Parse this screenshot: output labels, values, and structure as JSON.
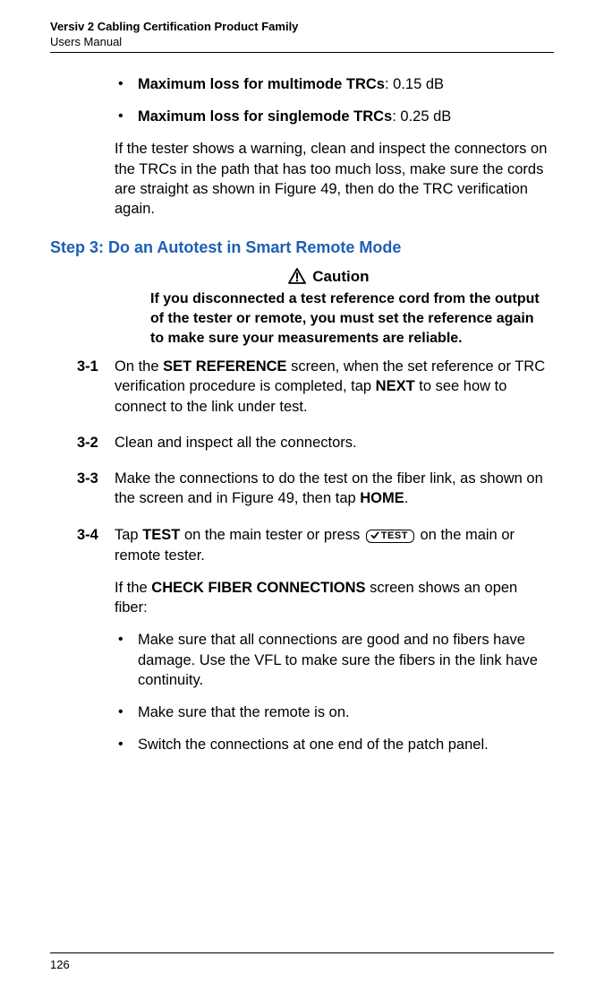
{
  "header": {
    "title": "Versiv 2 Cabling Certification Product Family",
    "subtitle": "Users Manual"
  },
  "bullets": {
    "mm_label": "Maximum loss for multimode TRCs",
    "mm_value": ": 0.15 dB",
    "sm_label": "Maximum loss for singlemode TRCs",
    "sm_value": ": 0.25 dB"
  },
  "warning_para": "If the tester shows a warning, clean and inspect the connectors on the TRCs in the path that has too much loss, make sure the cords are straight as shown in Figure 49, then do the TRC verification again.",
  "section_heading": "Step 3: Do an Autotest in Smart Remote Mode",
  "caution": {
    "label": "Caution",
    "body": "If you disconnected a test reference cord from the output of the tester or remote, you must set the reference again to make sure your measurements are reliable."
  },
  "steps": {
    "s1": {
      "num": "3-1",
      "pre": "On the ",
      "b1": "SET REFERENCE",
      "mid": " screen, when the set reference or TRC verification procedure is completed, tap ",
      "b2": "NEXT",
      "post": " to see how to connect to the link under test."
    },
    "s2": {
      "num": "3-2",
      "text": "Clean and inspect all the connectors."
    },
    "s3": {
      "num": "3-3",
      "pre": "Make the connections to do the test on the fiber link, as shown on the screen and in Figure 49, then tap ",
      "b1": "HOME",
      "post": "."
    },
    "s4": {
      "num": "3-4",
      "pre": "Tap ",
      "b1": "TEST",
      "mid": " on the main tester or press ",
      "post": " on the main or remote tester.",
      "key_label": "TEST",
      "check_pre": "If the ",
      "check_b": "CHECK FIBER CONNECTIONS",
      "check_post": " screen shows an open fiber:",
      "sub1": "Make sure that all connections are good and no fibers have damage. Use the VFL to make sure the fibers in the link have continuity.",
      "sub2": "Make sure that the remote is on.",
      "sub3": "Switch the connections at one end of the patch panel."
    }
  },
  "page_number": "126"
}
